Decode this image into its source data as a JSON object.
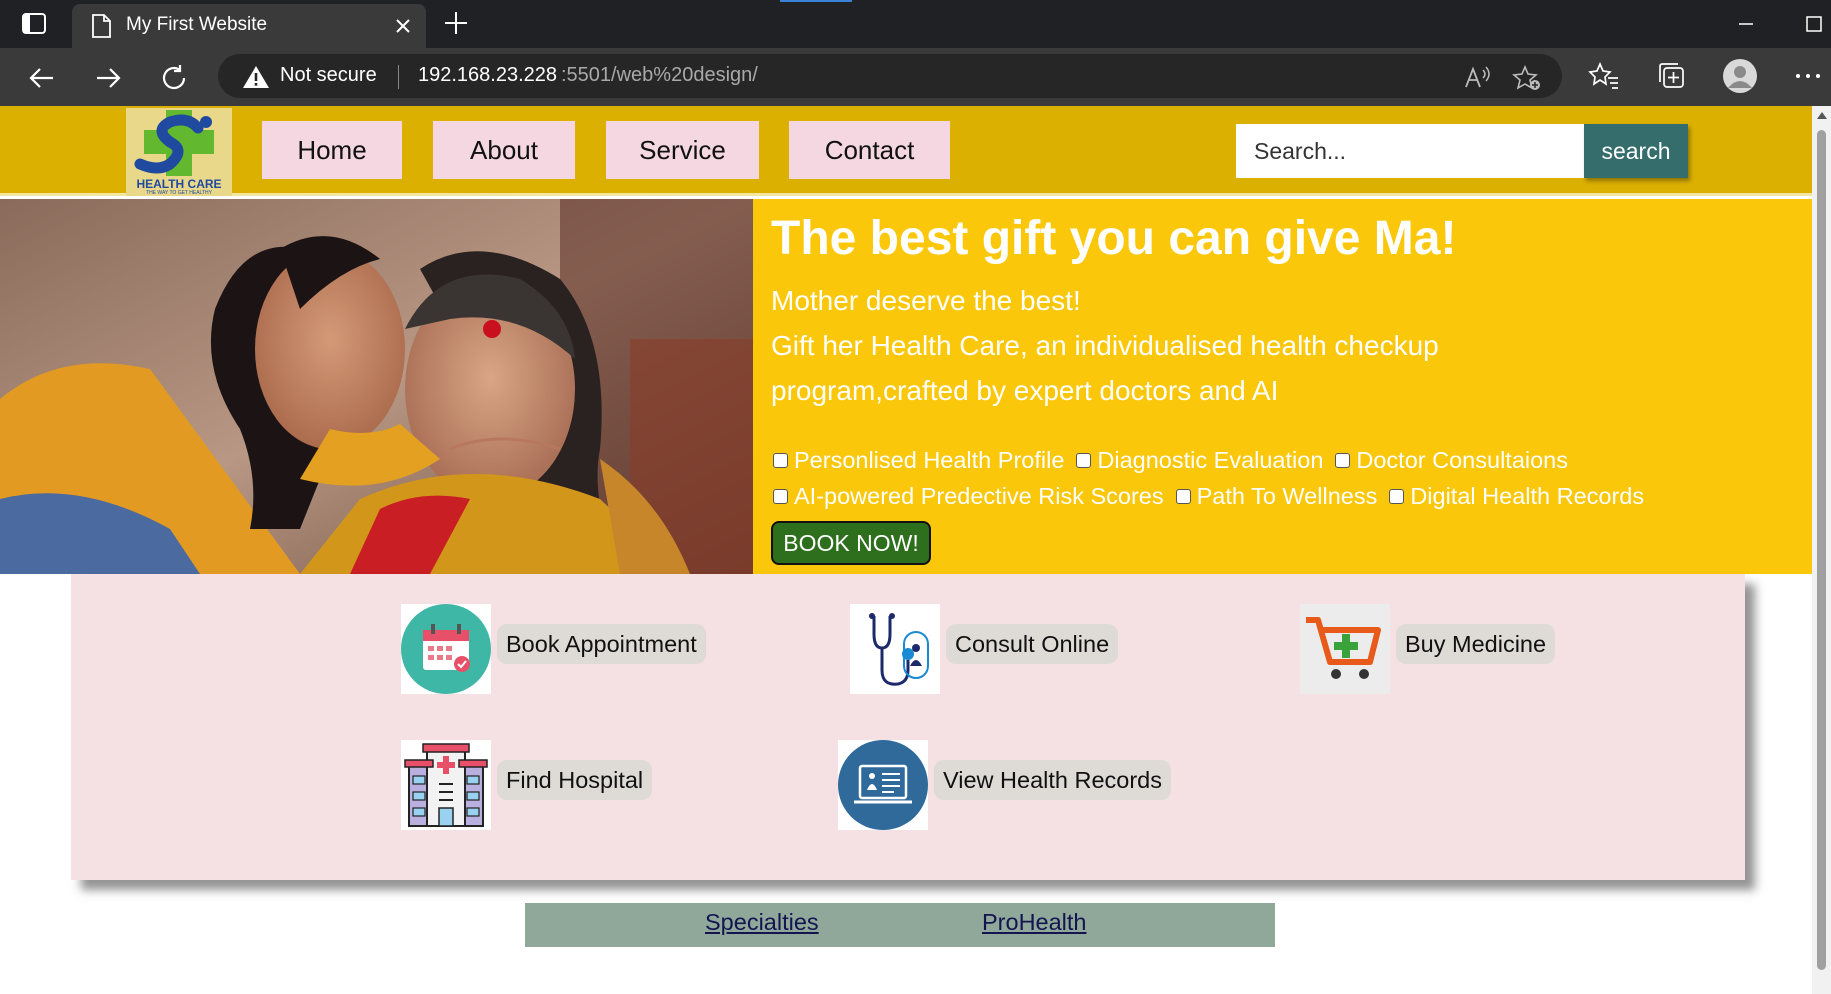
{
  "browser": {
    "tab_title": "My First Website",
    "security_label": "Not secure",
    "url_host": "192.168.23.228",
    "url_path": ":5501/web%20design/"
  },
  "site": {
    "logo_text": "HEALTH CARE",
    "logo_slogan": "THE WAY TO GET HEALTHY",
    "nav": [
      "Home",
      "About",
      "Service",
      "Contact"
    ],
    "search_placeholder": "Search...",
    "search_button": "search"
  },
  "hero": {
    "title": "The best gift you can give Ma!",
    "line1": "Mother deserve the best!",
    "line2": "Gift her Health Care, an individualised health checkup",
    "line3": "program,crafted by expert doctors and AI",
    "checkbox_row1": [
      "Personlised Health Profile",
      "Diagnostic Evaluation",
      "Doctor Consultaions"
    ],
    "checkbox_row2": [
      "AI-powered Predective Risk Scores",
      "Path To Wellness",
      "Digital Health Records"
    ],
    "book_button": "BOOK NOW!"
  },
  "services": [
    {
      "label": "Book Appointment",
      "icon": "calendar-icon"
    },
    {
      "label": "Consult Online",
      "icon": "stethoscope-icon"
    },
    {
      "label": "Buy Medicine",
      "icon": "cart-icon"
    },
    {
      "label": "Find Hospital",
      "icon": "hospital-icon"
    },
    {
      "label": "View Health Records",
      "icon": "health-records-icon"
    }
  ],
  "footer": {
    "links": [
      "Specialties",
      "ProHealth"
    ]
  },
  "colors": {
    "header": "#dbb000",
    "hero_bg": "#fbc70a",
    "nav_button": "#f4d7e1",
    "search_button": "#346d6c",
    "book_button": "#2e6f1e",
    "services_bg": "#f5e1e3",
    "footer_bg": "#8fa89a"
  }
}
